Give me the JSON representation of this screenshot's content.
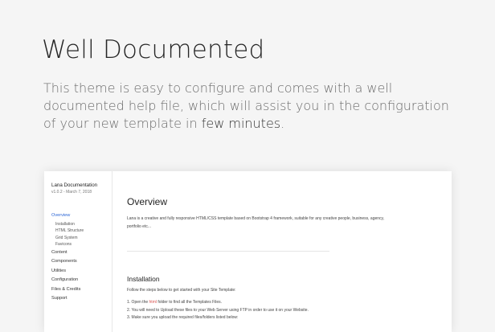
{
  "hero": {
    "title": "Well Documented",
    "desc_before": "This theme is easy to configure and comes with a well documented help file, which will assist you in the configuration of your new template in ",
    "desc_highlight": "few minutes",
    "desc_after": "."
  },
  "doc": {
    "brand": "Lana Documentation",
    "version": "v1.0.2 - March 7, 2018",
    "nav": {
      "overview": "Overview",
      "installation": "Installation",
      "html_structure": "HTML Structure",
      "grid_system": "Grid System",
      "favicons": "Favicons",
      "content": "Content",
      "components": "Components",
      "utilities": "Utilities",
      "configuration": "Configuration",
      "files_credits": "Files & Credits",
      "support": "Support"
    },
    "overview": {
      "title": "Overview",
      "text": "Lana is a creative and fully responsive HTML/CSS template based on Bootstrap 4 framework, suitable for any creative people, business, agency, portfolio etc..."
    },
    "installation": {
      "title": "Installation",
      "intro": "Follow the steps below to get started with your Site Template:",
      "step1_before": "1. Open the ",
      "step1_code": "html",
      "step1_after": " folder to find all the Templates Files.",
      "step2": "2. You will need to Upload these files to your Web Server using FTP in order to use it on your Website.",
      "step3": "3. Make sure you upload the required files/folders listed below:"
    }
  }
}
